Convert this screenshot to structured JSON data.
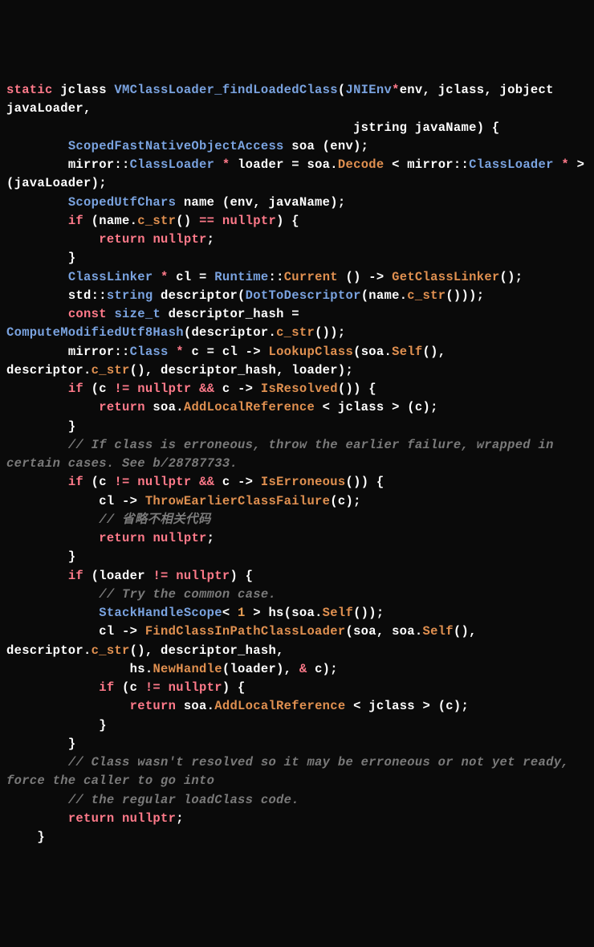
{
  "tokens": [
    {
      "cls": "kw",
      "txt": "static"
    },
    {
      "cls": "id",
      "txt": " jclass "
    },
    {
      "cls": "fn",
      "txt": "VMClassLoader_findLoadedClass"
    },
    {
      "cls": "id",
      "txt": "("
    },
    {
      "cls": "type",
      "txt": "JNIEnv"
    },
    {
      "cls": "op",
      "txt": "*"
    },
    {
      "cls": "id",
      "txt": "env, jclass, jobject javaLoader,\n                                             jstring javaName) {\n        "
    },
    {
      "cls": "type",
      "txt": "ScopedFastNativeObjectAccess"
    },
    {
      "cls": "id",
      "txt": " soa (env);\n        mirror::"
    },
    {
      "cls": "type",
      "txt": "ClassLoader"
    },
    {
      "cls": "id",
      "txt": " "
    },
    {
      "cls": "op",
      "txt": "*"
    },
    {
      "cls": "id",
      "txt": " loader = soa."
    },
    {
      "cls": "method",
      "txt": "Decode"
    },
    {
      "cls": "id",
      "txt": " < mirror::"
    },
    {
      "cls": "type",
      "txt": "ClassLoader"
    },
    {
      "cls": "id",
      "txt": " "
    },
    {
      "cls": "op",
      "txt": "*"
    },
    {
      "cls": "id",
      "txt": " > (javaLoader);\n        "
    },
    {
      "cls": "type",
      "txt": "ScopedUtfChars"
    },
    {
      "cls": "id",
      "txt": " name (env, javaName);\n        "
    },
    {
      "cls": "kw",
      "txt": "if"
    },
    {
      "cls": "id",
      "txt": " (name."
    },
    {
      "cls": "method",
      "txt": "c_str"
    },
    {
      "cls": "id",
      "txt": "() "
    },
    {
      "cls": "op",
      "txt": "=="
    },
    {
      "cls": "id",
      "txt": " "
    },
    {
      "cls": "kw",
      "txt": "nullptr"
    },
    {
      "cls": "id",
      "txt": ") {\n            "
    },
    {
      "cls": "kw",
      "txt": "return"
    },
    {
      "cls": "id",
      "txt": " "
    },
    {
      "cls": "kw",
      "txt": "nullptr"
    },
    {
      "cls": "id",
      "txt": ";\n        }\n        "
    },
    {
      "cls": "type",
      "txt": "ClassLinker"
    },
    {
      "cls": "id",
      "txt": " "
    },
    {
      "cls": "op",
      "txt": "*"
    },
    {
      "cls": "id",
      "txt": " cl = "
    },
    {
      "cls": "type",
      "txt": "Runtime"
    },
    {
      "cls": "id",
      "txt": "::"
    },
    {
      "cls": "method",
      "txt": "Current"
    },
    {
      "cls": "id",
      "txt": " () -> "
    },
    {
      "cls": "method",
      "txt": "GetClassLinker"
    },
    {
      "cls": "id",
      "txt": "();\n        std::"
    },
    {
      "cls": "type",
      "txt": "string"
    },
    {
      "cls": "id",
      "txt": " descriptor("
    },
    {
      "cls": "fn",
      "txt": "DotToDescriptor"
    },
    {
      "cls": "id",
      "txt": "(name."
    },
    {
      "cls": "method",
      "txt": "c_str"
    },
    {
      "cls": "id",
      "txt": "()));\n        "
    },
    {
      "cls": "kw",
      "txt": "const"
    },
    {
      "cls": "id",
      "txt": " "
    },
    {
      "cls": "type",
      "txt": "size_t"
    },
    {
      "cls": "id",
      "txt": " descriptor_hash = "
    },
    {
      "cls": "fn",
      "txt": "ComputeModifiedUtf8Hash"
    },
    {
      "cls": "id",
      "txt": "(descriptor."
    },
    {
      "cls": "method",
      "txt": "c_str"
    },
    {
      "cls": "id",
      "txt": "());\n        mirror::"
    },
    {
      "cls": "type",
      "txt": "Class"
    },
    {
      "cls": "id",
      "txt": " "
    },
    {
      "cls": "op",
      "txt": "*"
    },
    {
      "cls": "id",
      "txt": " c = cl -> "
    },
    {
      "cls": "method",
      "txt": "LookupClass"
    },
    {
      "cls": "id",
      "txt": "(soa."
    },
    {
      "cls": "method",
      "txt": "Self"
    },
    {
      "cls": "id",
      "txt": "(), descriptor."
    },
    {
      "cls": "method",
      "txt": "c_str"
    },
    {
      "cls": "id",
      "txt": "(), descriptor_hash, loader);\n        "
    },
    {
      "cls": "kw",
      "txt": "if"
    },
    {
      "cls": "id",
      "txt": " (c "
    },
    {
      "cls": "op",
      "txt": "!="
    },
    {
      "cls": "id",
      "txt": " "
    },
    {
      "cls": "kw",
      "txt": "nullptr"
    },
    {
      "cls": "id",
      "txt": " "
    },
    {
      "cls": "op",
      "txt": "&&"
    },
    {
      "cls": "id",
      "txt": " c -> "
    },
    {
      "cls": "method",
      "txt": "IsResolved"
    },
    {
      "cls": "id",
      "txt": "()) {\n            "
    },
    {
      "cls": "kw",
      "txt": "return"
    },
    {
      "cls": "id",
      "txt": " soa."
    },
    {
      "cls": "method",
      "txt": "AddLocalReference"
    },
    {
      "cls": "id",
      "txt": " < jclass > (c);\n        }\n        "
    },
    {
      "cls": "com",
      "txt": "// If class is erroneous, throw the earlier failure, wrapped in certain cases. See b/28787733."
    },
    {
      "cls": "id",
      "txt": "\n        "
    },
    {
      "cls": "kw",
      "txt": "if"
    },
    {
      "cls": "id",
      "txt": " (c "
    },
    {
      "cls": "op",
      "txt": "!="
    },
    {
      "cls": "id",
      "txt": " "
    },
    {
      "cls": "kw",
      "txt": "nullptr"
    },
    {
      "cls": "id",
      "txt": " "
    },
    {
      "cls": "op",
      "txt": "&&"
    },
    {
      "cls": "id",
      "txt": " c -> "
    },
    {
      "cls": "method",
      "txt": "IsErroneous"
    },
    {
      "cls": "id",
      "txt": "()) {\n            cl -> "
    },
    {
      "cls": "method",
      "txt": "ThrowEarlierClassFailure"
    },
    {
      "cls": "id",
      "txt": "(c);\n            "
    },
    {
      "cls": "com",
      "txt": "// 省略不相关代码"
    },
    {
      "cls": "id",
      "txt": "\n            "
    },
    {
      "cls": "kw",
      "txt": "return"
    },
    {
      "cls": "id",
      "txt": " "
    },
    {
      "cls": "kw",
      "txt": "nullptr"
    },
    {
      "cls": "id",
      "txt": ";\n        }\n        "
    },
    {
      "cls": "kw",
      "txt": "if"
    },
    {
      "cls": "id",
      "txt": " (loader "
    },
    {
      "cls": "op",
      "txt": "!="
    },
    {
      "cls": "id",
      "txt": " "
    },
    {
      "cls": "kw",
      "txt": "nullptr"
    },
    {
      "cls": "id",
      "txt": ") {\n            "
    },
    {
      "cls": "com",
      "txt": "// Try the common case."
    },
    {
      "cls": "id",
      "txt": "\n            "
    },
    {
      "cls": "type",
      "txt": "StackHandleScope"
    },
    {
      "cls": "id",
      "txt": "< "
    },
    {
      "cls": "num",
      "txt": "1"
    },
    {
      "cls": "id",
      "txt": " > hs(soa."
    },
    {
      "cls": "method",
      "txt": "Self"
    },
    {
      "cls": "id",
      "txt": "());\n            cl -> "
    },
    {
      "cls": "method",
      "txt": "FindClassInPathClassLoader"
    },
    {
      "cls": "id",
      "txt": "(soa, soa."
    },
    {
      "cls": "method",
      "txt": "Self"
    },
    {
      "cls": "id",
      "txt": "(), descriptor."
    },
    {
      "cls": "method",
      "txt": "c_str"
    },
    {
      "cls": "id",
      "txt": "(), descriptor_hash,\n                hs."
    },
    {
      "cls": "method",
      "txt": "NewHandle"
    },
    {
      "cls": "id",
      "txt": "(loader), "
    },
    {
      "cls": "op",
      "txt": "&"
    },
    {
      "cls": "id",
      "txt": " c);\n            "
    },
    {
      "cls": "kw",
      "txt": "if"
    },
    {
      "cls": "id",
      "txt": " (c "
    },
    {
      "cls": "op",
      "txt": "!="
    },
    {
      "cls": "id",
      "txt": " "
    },
    {
      "cls": "kw",
      "txt": "nullptr"
    },
    {
      "cls": "id",
      "txt": ") {\n                "
    },
    {
      "cls": "kw",
      "txt": "return"
    },
    {
      "cls": "id",
      "txt": " soa."
    },
    {
      "cls": "method",
      "txt": "AddLocalReference"
    },
    {
      "cls": "id",
      "txt": " < jclass > (c);\n            }\n        }\n        "
    },
    {
      "cls": "com",
      "txt": "// Class wasn't resolved so it may be erroneous or not yet ready, force the caller to go into"
    },
    {
      "cls": "id",
      "txt": "\n        "
    },
    {
      "cls": "com",
      "txt": "// the regular loadClass code."
    },
    {
      "cls": "id",
      "txt": "\n        "
    },
    {
      "cls": "kw",
      "txt": "return"
    },
    {
      "cls": "id",
      "txt": " "
    },
    {
      "cls": "kw",
      "txt": "nullptr"
    },
    {
      "cls": "id",
      "txt": ";\n    }"
    }
  ]
}
